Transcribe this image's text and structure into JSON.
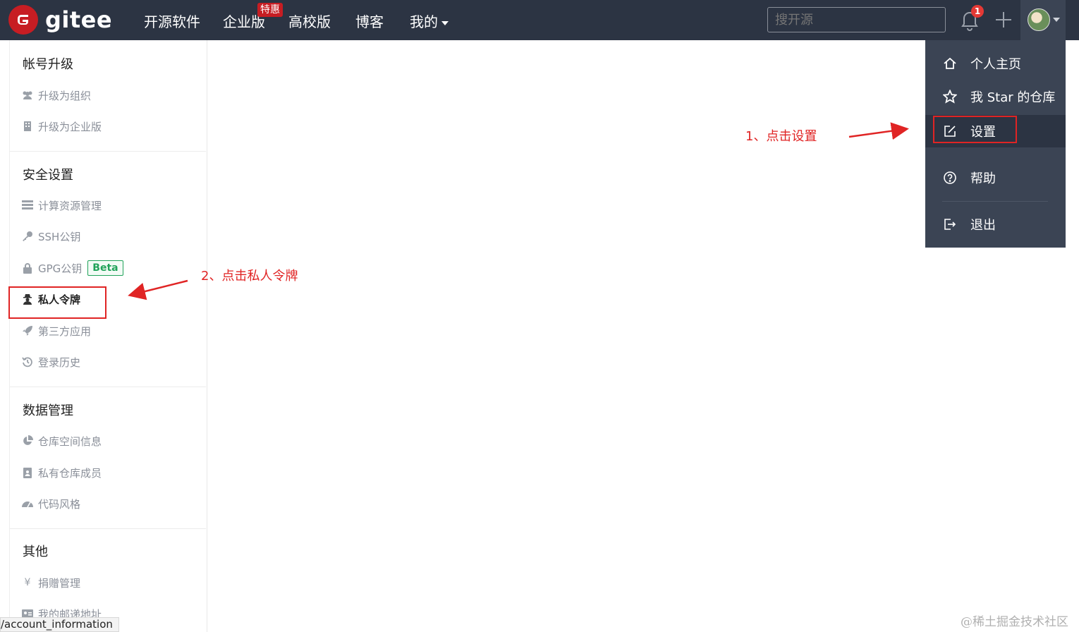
{
  "topbar": {
    "logo_text": "gitee",
    "nav": [
      "开源软件",
      "企业版",
      "高校版",
      "博客",
      "我的"
    ],
    "promo_badge": "特惠",
    "search_placeholder": "搜开源",
    "notification_count": "1"
  },
  "sidebar": {
    "sections": [
      {
        "title": "帐号升级",
        "items": [
          {
            "icon": "users-icon",
            "label": "升级为组织"
          },
          {
            "icon": "building-icon",
            "label": "升级为企业版"
          }
        ]
      },
      {
        "title": "安全设置",
        "items": [
          {
            "icon": "server-icon",
            "label": "计算资源管理"
          },
          {
            "icon": "key-icon",
            "label": "SSH公钥"
          },
          {
            "icon": "lock-icon",
            "label": "GPG公钥",
            "badge": "Beta"
          },
          {
            "icon": "user-secret-icon",
            "label": "私人令牌",
            "active": true
          },
          {
            "icon": "rocket-icon",
            "label": "第三方应用"
          },
          {
            "icon": "history-icon",
            "label": "登录历史"
          }
        ]
      },
      {
        "title": "数据管理",
        "items": [
          {
            "icon": "pie-chart-icon",
            "label": "仓库空间信息"
          },
          {
            "icon": "contact-book-icon",
            "label": "私有仓库成员"
          },
          {
            "icon": "gauge-icon",
            "label": "代码风格"
          }
        ]
      },
      {
        "title": "其他",
        "items": [
          {
            "icon": "yen-icon",
            "label": "捐赠管理"
          },
          {
            "icon": "address-card-icon",
            "label": "我的邮递地址"
          }
        ]
      }
    ]
  },
  "dropdown": {
    "items": [
      {
        "icon": "home-icon",
        "label": "个人主页"
      },
      {
        "icon": "star-icon",
        "label": "我 Star 的仓库"
      },
      {
        "icon": "edit-icon",
        "label": "设置"
      },
      {
        "icon": "help-icon",
        "label": "帮助"
      },
      {
        "icon": "logout-icon",
        "label": "退出"
      }
    ]
  },
  "annotations": {
    "step1": "1、点击设置",
    "step2": "2、点击私人令牌"
  },
  "status_bar": "/account_information",
  "watermark": "@稀土掘金技术社区",
  "colors": {
    "topbar_bg": "#2c3443",
    "dropdown_bg": "#3b4454",
    "brand_red": "#c71d23",
    "annotation_red": "#e02424",
    "beta_green": "#21a35a"
  }
}
